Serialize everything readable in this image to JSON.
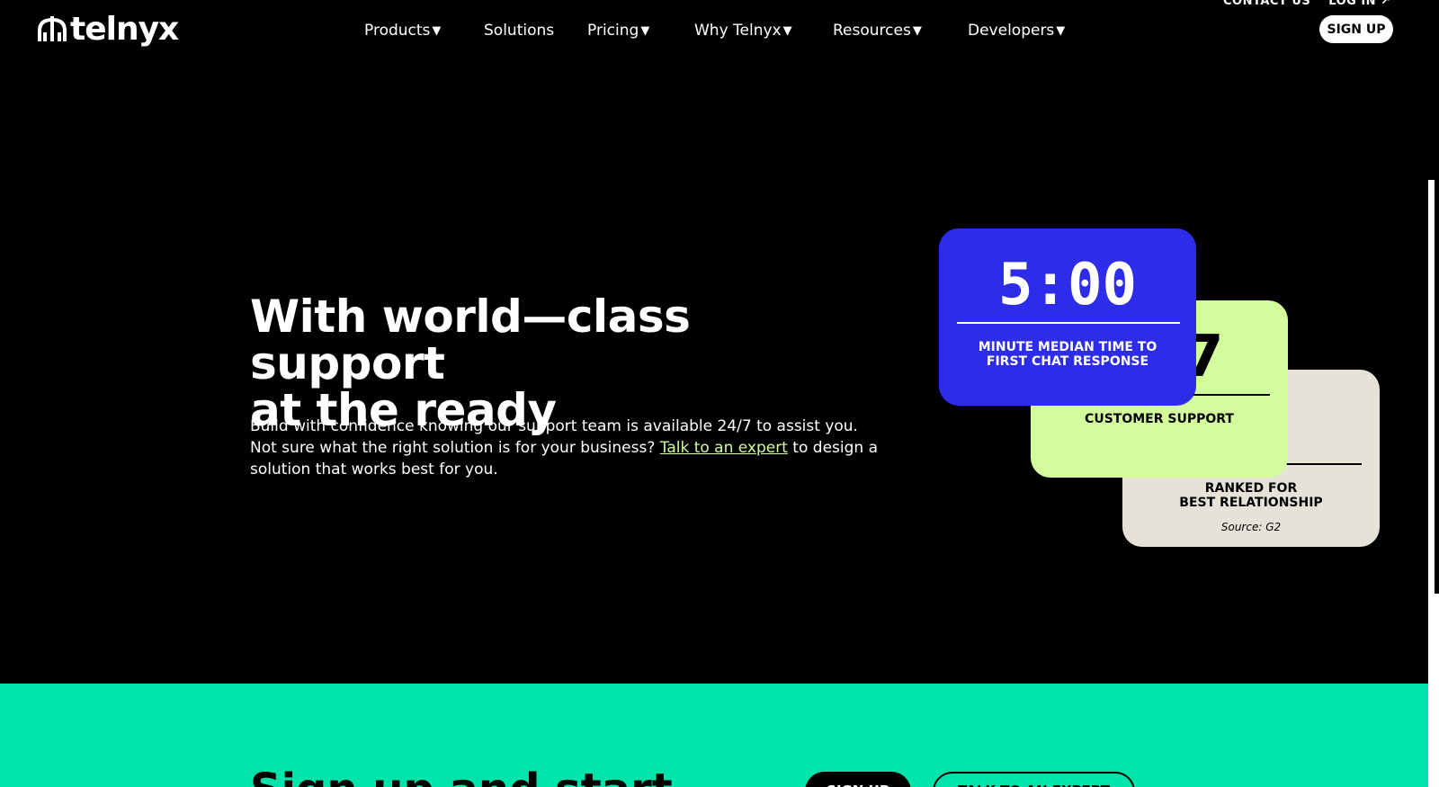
{
  "header": {
    "logo_text": "telnyx",
    "nav": [
      {
        "label": "Products",
        "caret": "▼"
      },
      {
        "label": "Solutions",
        "caret": ""
      },
      {
        "label": "Pricing",
        "caret": "▼"
      },
      {
        "label": "Why Telnyx",
        "caret": "▼"
      },
      {
        "label": "Resources",
        "caret": "▼"
      },
      {
        "label": "Developers",
        "caret": "▼"
      }
    ],
    "contact_us": "CONTACT US",
    "log_in": "LOG IN",
    "sign_up": "SIGN UP"
  },
  "hero": {
    "title_line1": "With world—class support",
    "title_line2": "at the ready",
    "body_part1": "Build with confidence knowing our support team is available 24/7 to assist you. Not sure what the right solution is for your business? ",
    "link_text": "Talk to an expert",
    "body_part2": " to design a solution that works best for you."
  },
  "stats": {
    "blue": {
      "value": "5:00",
      "label": "MINUTE MEDIAN TIME TO FIRST CHAT RESPONSE"
    },
    "green": {
      "value": "7",
      "label": "CUSTOMER SUPPORT"
    },
    "beige": {
      "label_line1": "RANKED FOR",
      "label_line2": "BEST RELATIONSHIP",
      "source": "Source: G2"
    }
  },
  "cta": {
    "title": "Sign up and start",
    "sign_up": "SIGN UP",
    "talk_to_expert": "TALK TO AN EXPERT"
  },
  "colors": {
    "background": "#000000",
    "accent_green": "#d3fd9d",
    "accent_blue": "#2d2ce8",
    "beige": "#e5e3d7",
    "cta_teal": "#00e3aa",
    "link_green": "#d0fc9c"
  }
}
